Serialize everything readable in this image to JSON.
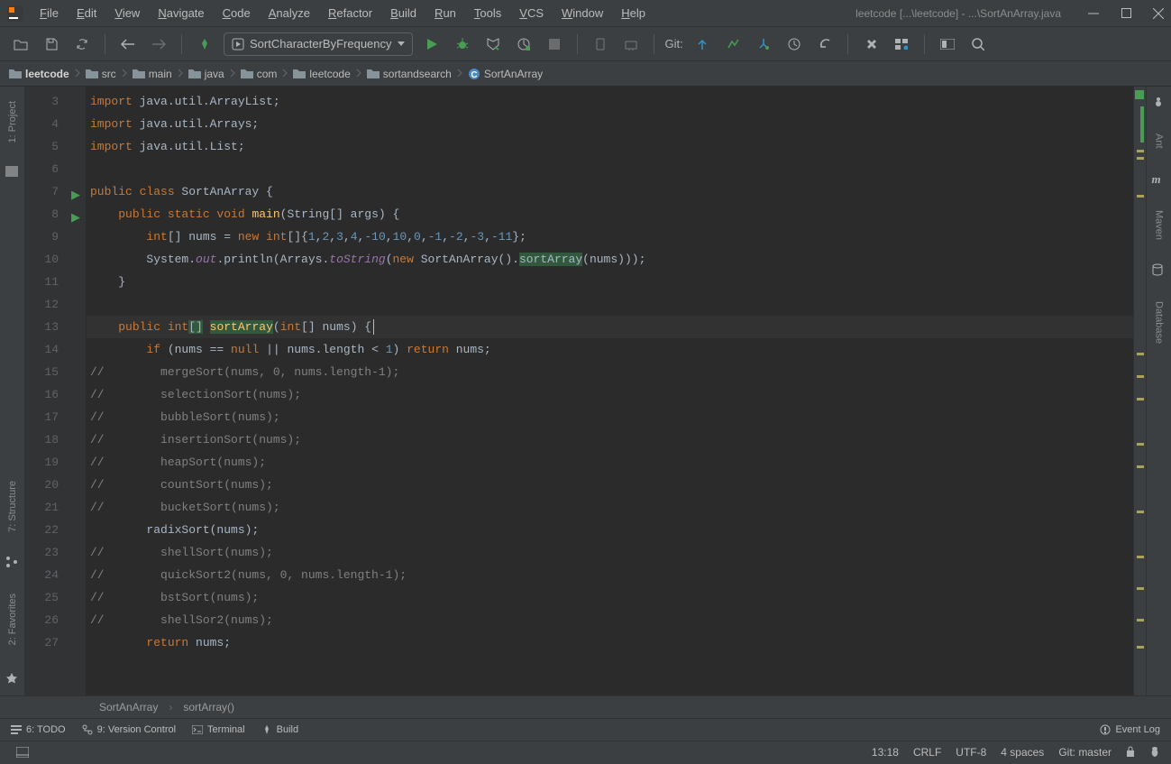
{
  "title": "leetcode [...\\leetcode] - ...\\SortAnArray.java",
  "menu": [
    "File",
    "Edit",
    "View",
    "Navigate",
    "Code",
    "Analyze",
    "Refactor",
    "Build",
    "Run",
    "Tools",
    "VCS",
    "Window",
    "Help"
  ],
  "runConfig": "SortCharacterByFrequency",
  "gitLabel": "Git:",
  "breadcrumbs": [
    "leetcode",
    "src",
    "main",
    "java",
    "com",
    "leetcode",
    "sortandsearch",
    "SortAnArray"
  ],
  "leftTabs": [
    "1: Project",
    "7: Structure",
    "2: Favorites"
  ],
  "rightTabs": [
    "Ant",
    "Maven",
    "Database"
  ],
  "lines": [
    {
      "n": 3,
      "html": "<span class='kw'>import </span><span class='txt'>java.util.ArrayList;</span>"
    },
    {
      "n": 4,
      "html": "<span class='kw'>import </span><span class='txt'>java.util.Arrays;</span>"
    },
    {
      "n": 5,
      "html": "<span class='kw'>import </span><span class='txt'>java.util.List;</span>"
    },
    {
      "n": 6,
      "html": ""
    },
    {
      "n": 7,
      "run": true,
      "html": "<span class='kw'>public class </span><span class='txt'>SortAnArray {</span>"
    },
    {
      "n": 8,
      "run": true,
      "html": "    <span class='kw'>public static void </span><span class='mth'>main</span><span class='txt'>(String[] args) {</span>"
    },
    {
      "n": 9,
      "html": "        <span class='kw'>int</span><span class='txt'>[] nums = </span><span class='kw'>new int</span><span class='txt'>[]{</span><span class='num'>1</span><span class='txt'>,</span><span class='num'>2</span><span class='txt'>,</span><span class='num'>3</span><span class='txt'>,</span><span class='num'>4</span><span class='txt'>,</span><span class='num'>-10</span><span class='txt'>,</span><span class='num'>10</span><span class='txt'>,</span><span class='num'>0</span><span class='txt'>,</span><span class='num'>-1</span><span class='txt'>,</span><span class='num'>-2</span><span class='txt'>,</span><span class='num'>-3</span><span class='txt'>,</span><span class='num'>-11</span><span class='txt'>};</span>"
    },
    {
      "n": 10,
      "html": "        <span class='txt'>System.</span><span class='fld'>out</span><span class='txt'>.println(Arrays.</span><span class='fld'>toString</span><span class='txt'>(</span><span class='kw'>new </span><span class='txt'>SortAnArray().</span><span class='hl txt'>sortArray</span><span class='txt'>(nums)));</span>"
    },
    {
      "n": 11,
      "html": "    <span class='txt'>}</span>"
    },
    {
      "n": 12,
      "html": ""
    },
    {
      "n": 13,
      "cur": true,
      "html": "    <span class='kw'>public int</span><span class='hl txt'>[]</span><span class='txt'> </span><span class='mth hl'>sortArray</span><span class='txt'>(</span><span class='kw'>int</span><span class='txt'>[] nums) {</span><span class='cursor'></span>"
    },
    {
      "n": 14,
      "html": "        <span class='kw'>if </span><span class='txt'>(nums == </span><span class='kw'>null </span><span class='txt'>|| nums.length &lt; </span><span class='num'>1</span><span class='txt'>) </span><span class='kw'>return </span><span class='txt'>nums;</span>"
    },
    {
      "n": 15,
      "html": "<span class='com'>//        mergeSort(nums, 0, nums.length-1);</span>"
    },
    {
      "n": 16,
      "html": "<span class='com'>//        selectionSort(nums);</span>"
    },
    {
      "n": 17,
      "html": "<span class='com'>//        bubbleSort(nums);</span>"
    },
    {
      "n": 18,
      "html": "<span class='com'>//        insertionSort(nums);</span>"
    },
    {
      "n": 19,
      "html": "<span class='com'>//        heapSort(nums);</span>"
    },
    {
      "n": 20,
      "html": "<span class='com'>//        countSort(nums);</span>"
    },
    {
      "n": 21,
      "html": "<span class='com'>//        bucketSort(nums);</span>"
    },
    {
      "n": 22,
      "html": "        <span class='txt'>radixSort(nums);</span>"
    },
    {
      "n": 23,
      "html": "<span class='com'>//        shellSort(nums);</span>"
    },
    {
      "n": 24,
      "html": "<span class='com'>//        quickSort2(nums, 0, nums.length-1);</span>"
    },
    {
      "n": 25,
      "html": "<span class='com'>//        bstSort(nums);</span>"
    },
    {
      "n": 26,
      "html": "<span class='com'>//        shellSor2(nums);</span>"
    },
    {
      "n": 27,
      "html": "        <span class='kw'>return </span><span class='txt'>nums;</span>"
    }
  ],
  "crumbBar": [
    "SortAnArray",
    "sortArray()"
  ],
  "bottomTabs": [
    "6: TODO",
    "9: Version Control",
    "Terminal",
    "Build"
  ],
  "eventLog": "Event Log",
  "status": {
    "pos": "13:18",
    "lineEnd": "CRLF",
    "enc": "UTF-8",
    "indent": "4 spaces",
    "git": "Git: master"
  }
}
